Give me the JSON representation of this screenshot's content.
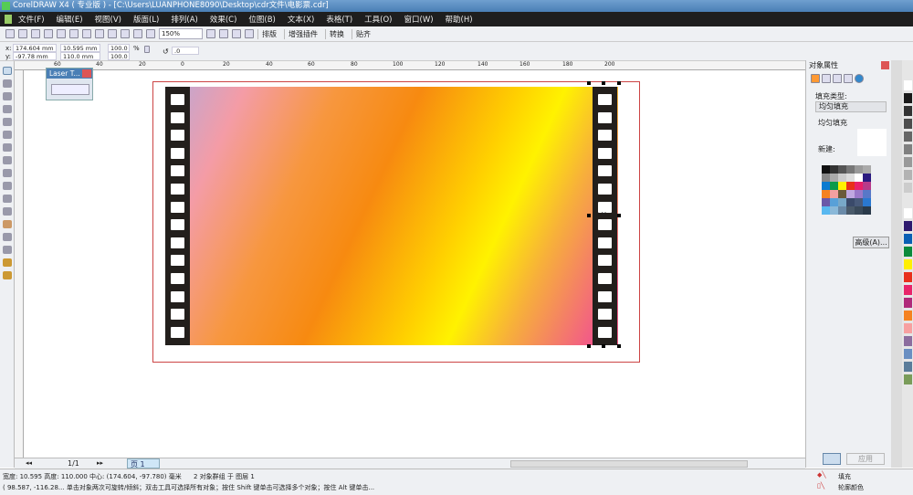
{
  "title": "CorelDRAW X4 ( 专业版 ) - [C:\\Users\\LUANPHONE8090\\Desktop\\cdr文件\\电影票.cdr]",
  "menu": [
    "文件(F)",
    "编辑(E)",
    "视图(V)",
    "版面(L)",
    "排列(A)",
    "效果(C)",
    "位图(B)",
    "文本(X)",
    "表格(T)",
    "工具(O)",
    "窗口(W)",
    "帮助(H)"
  ],
  "toolbar": {
    "zoom": "150%",
    "buttons": [
      "排版",
      "增强插件",
      "转换",
      "贴齐"
    ]
  },
  "props": {
    "x": "174.604 mm",
    "y": "-97.78 mm",
    "w": "10.595 mm",
    "h": "110.0 mm",
    "sx": "100.0",
    "sy": "100.0",
    "pct": "%",
    "angle": ".0"
  },
  "ruler_ticks": [
    "60",
    "40",
    "20",
    "0",
    "20",
    "40",
    "60",
    "80",
    "100",
    "120",
    "140",
    "160",
    "180",
    "200"
  ],
  "laser": {
    "title": "Laser T..."
  },
  "docker": {
    "title": "对象属性",
    "fill_type_label": "填充类型:",
    "fill_type": "均匀填充",
    "section": "均匀填充",
    "new_label": "新建:",
    "advanced": "高级(A)...",
    "apply": "应用"
  },
  "palette_colors": [
    "#ffffff",
    "#1a1a1a",
    "#333",
    "#4d4d4d",
    "#666",
    "#808080",
    "#999",
    "#b3b3b3",
    "#ccc",
    "#e6e6e6",
    "#fff",
    "#2e1a6e",
    "#0a5fb4",
    "#0b8a3b",
    "#ffef00",
    "#e8301c",
    "#e8256a",
    "#b02a7a",
    "#f58220",
    "#f7a0a0",
    "#8c6d9e",
    "#6a8fc2",
    "#5a7c9a",
    "#7a9c5a"
  ],
  "swatches": [
    "#111",
    "#333",
    "#555",
    "#777",
    "#999",
    "#aaa",
    "#888",
    "#aaa",
    "#ccc",
    "#ddd",
    "#fff",
    "#2a1a80",
    "#0b7bd0",
    "#0a9a4a",
    "#fff200",
    "#e83018",
    "#e8206a",
    "#b83a8a",
    "#f58220",
    "#f4a0a0",
    "#6a5a3a",
    "#c0a8e0",
    "#9a78c8",
    "#5878c8",
    "#6a58a8",
    "#58a0d8",
    "#78a8c8",
    "#3a4a6a",
    "#485a7a",
    "#2a78d0",
    "#58b8f0",
    "#8ab8d8",
    "#6a8aa8",
    "#4a5a6a",
    "#3a4a5a",
    "#2a3a4a"
  ],
  "pagenav": {
    "count": "1/1",
    "tab": "页 1"
  },
  "status": {
    "line1": "宽度: 10.595  高度: 110.000  中心: (174.604, -97.780)  毫米",
    "group": "2 对象群组 于 图层 1",
    "line2": "( 98.587, -116.28... 单击对象两次可旋转/倾斜；双击工具可选择所有对象；按住 Shift 键单击可选择多个对象；按住 Alt 键单击...",
    "fill": "填充",
    "outline": "轮廓颜色"
  }
}
